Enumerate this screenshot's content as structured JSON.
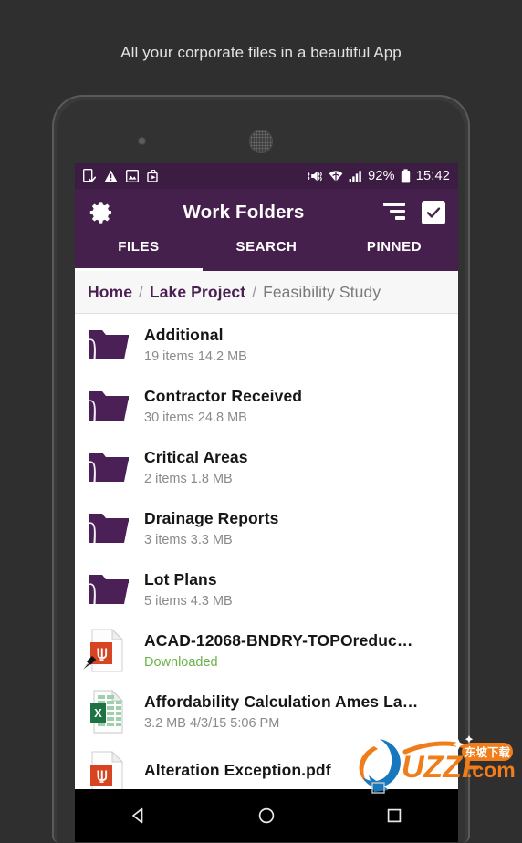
{
  "tagline": "All your corporate files in a beautiful App",
  "statusbar": {
    "left_icons": [
      "download-done-icon",
      "warning-icon",
      "image-icon",
      "work-profile-icon"
    ],
    "right_icons": [
      "volume-mute-icon",
      "wifi-icon",
      "signal-icon"
    ],
    "battery": "92%",
    "time": "15:42"
  },
  "appbar": {
    "title": "Work Folders",
    "gear_icon": "gear-icon",
    "sort_icon": "sort-icon",
    "check_icon": "checkbox-checked-icon",
    "bg_color": "#46204d",
    "statusbar_color": "#3d1c44"
  },
  "tabs": [
    {
      "label": "FILES",
      "active": true
    },
    {
      "label": "SEARCH",
      "active": false
    },
    {
      "label": "PINNED",
      "active": false
    }
  ],
  "breadcrumb": {
    "separator": "/",
    "items": [
      {
        "label": "Home",
        "current": false
      },
      {
        "label": "Lake Project",
        "current": false
      },
      {
        "label": "Feasibility Study",
        "current": true
      }
    ]
  },
  "list": [
    {
      "icon": "folder-icon",
      "title": "Additional",
      "subtitle": "19 items 14.2 MB",
      "downloaded": false,
      "pinned": false
    },
    {
      "icon": "folder-icon",
      "title": "Contractor Received",
      "subtitle": "30 items 24.8 MB",
      "downloaded": false,
      "pinned": false
    },
    {
      "icon": "folder-icon",
      "title": "Critical Areas",
      "subtitle": "2 items 1.8 MB",
      "downloaded": false,
      "pinned": false
    },
    {
      "icon": "folder-icon",
      "title": "Drainage Reports",
      "subtitle": "3 items 3.3 MB",
      "downloaded": false,
      "pinned": false
    },
    {
      "icon": "folder-icon",
      "title": "Lot Plans",
      "subtitle": "5 items 4.3 MB",
      "downloaded": false,
      "pinned": false
    },
    {
      "icon": "pdf-file-icon",
      "title": "ACAD-12068-BNDRY-TOPOreduc…",
      "subtitle": "Downloaded",
      "downloaded": true,
      "pinned": true
    },
    {
      "icon": "excel-file-icon",
      "title": "Affordability Calculation Ames La…",
      "subtitle": "3.2 MB  4/3/15 5:06 PM",
      "downloaded": false,
      "pinned": false
    },
    {
      "icon": "pdf-file-icon",
      "title": "Alteration Exception.pdf",
      "subtitle": "",
      "downloaded": false,
      "pinned": false
    }
  ],
  "navbar": {
    "back": "back-triangle-icon",
    "home": "home-circle-icon",
    "recents": "recents-square-icon"
  },
  "watermark": {
    "text": "UZZF",
    "domain": ".com",
    "badge": "东坡下载"
  },
  "colors": {
    "purple": "#46204d",
    "folder": "#4b2057",
    "downloaded_green": "#6cb24a",
    "pdf_red": "#d64421",
    "excel_green": "#1f7244"
  }
}
